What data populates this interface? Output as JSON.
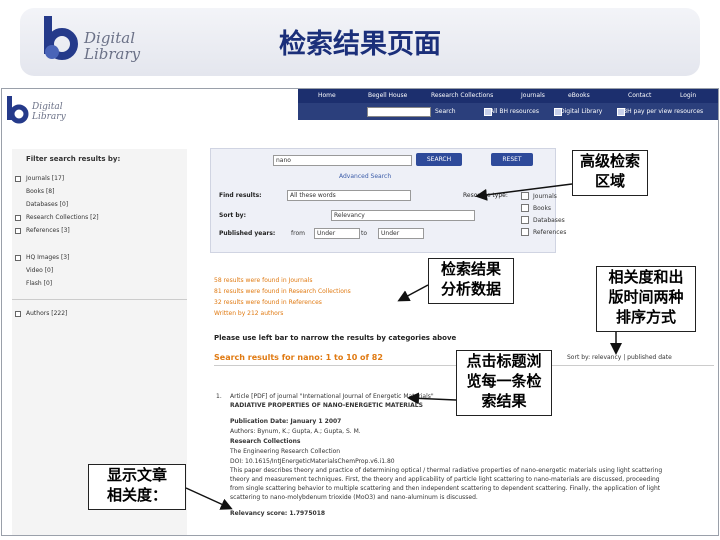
{
  "slide": {
    "title": "检索结果页面",
    "logo_line1": "Digital",
    "logo_line2": "Library"
  },
  "site": {
    "logo_line1": "Digital",
    "logo_line2": "Library",
    "nav": [
      "Home",
      "Begell House",
      "Research Collections",
      "Journals",
      "eBooks",
      "Contact",
      "Login"
    ],
    "search_button": "Search",
    "subnav": [
      "All BH resources",
      "Digital Library",
      "BH pay per view resources"
    ]
  },
  "sidebar": {
    "title": "Filter search results by:",
    "items": [
      "Journals [17]",
      "Books [8]",
      "Databases [0]",
      "Research Collections [2]",
      "References [3]",
      "HQ Images [3]",
      "Video [0]",
      "Flash [0]",
      "Authors [222]"
    ]
  },
  "search_panel": {
    "query": "nano",
    "search_btn": "SEARCH",
    "reset_btn": "RESET",
    "advanced": "Advanced Search",
    "find_label": "Find results:",
    "find_value": "All these words",
    "sort_label": "Sort by:",
    "sort_value": "Relevancy",
    "years_label": "Published years:",
    "from_label": "from",
    "from_value": "Under",
    "to_label": "to",
    "to_value": "Under",
    "resource_label": "Resource type:",
    "resource_options": [
      "Journals",
      "Books",
      "Databases",
      "References"
    ]
  },
  "summary": {
    "lines": [
      "58 results were found in Journals",
      "81 results were found in Research Collections",
      "32 results were found in References",
      "Written by 212 authors"
    ],
    "hint": "Please use left bar to narrow the results by categories above",
    "results_heading": "Search results for nano: 1 to 10 of 82",
    "sort_by": "Sort by: relevancy | published date"
  },
  "result": {
    "number": "1.",
    "title_line1": "Article [PDF] of journal \"International Journal of Energetic Materials\"",
    "title_line2": "RADIATIVE PROPERTIES OF NANO-ENERGETIC MATERIALS",
    "pub_date": "Publication Date: January 1 2007",
    "authors": "Authors: Bynum, K.; Gupta, A.; Gupta, S. M.",
    "collection_label": "Research Collections",
    "collection": "The Engineering Research Collection",
    "doi": "DOI: 10.1615/IntJEnergeticMaterialsChemProp.v6.i1.80",
    "abstract": [
      "This paper describes theory and practice of determining optical / thermal radiative properties of nano-energetic materials using light scattering",
      "theory and measurement techniques. First, the theory and applicability of particle light scattering to nano-materials are discussed, proceeding",
      "from single scattering behavior to multiple scattering and then independent scattering to dependent scattering. Finally, the application of light",
      "scattering to nano-molybdenum trioxide (MoO3) and nano-aluminum is discussed."
    ],
    "relevancy": "Relevancy score: 1.7975018"
  },
  "callouts": {
    "advanced_area": [
      "高级检索",
      "区域"
    ],
    "analysis": [
      "检索结果",
      "分析数据"
    ],
    "sort_modes": [
      "相关度和出",
      "版时间两种",
      "排序方式"
    ],
    "click_title": [
      "点击标题浏",
      "览每一条检",
      "索结果"
    ],
    "relevancy": [
      "显示文章",
      "相关度："
    ]
  }
}
